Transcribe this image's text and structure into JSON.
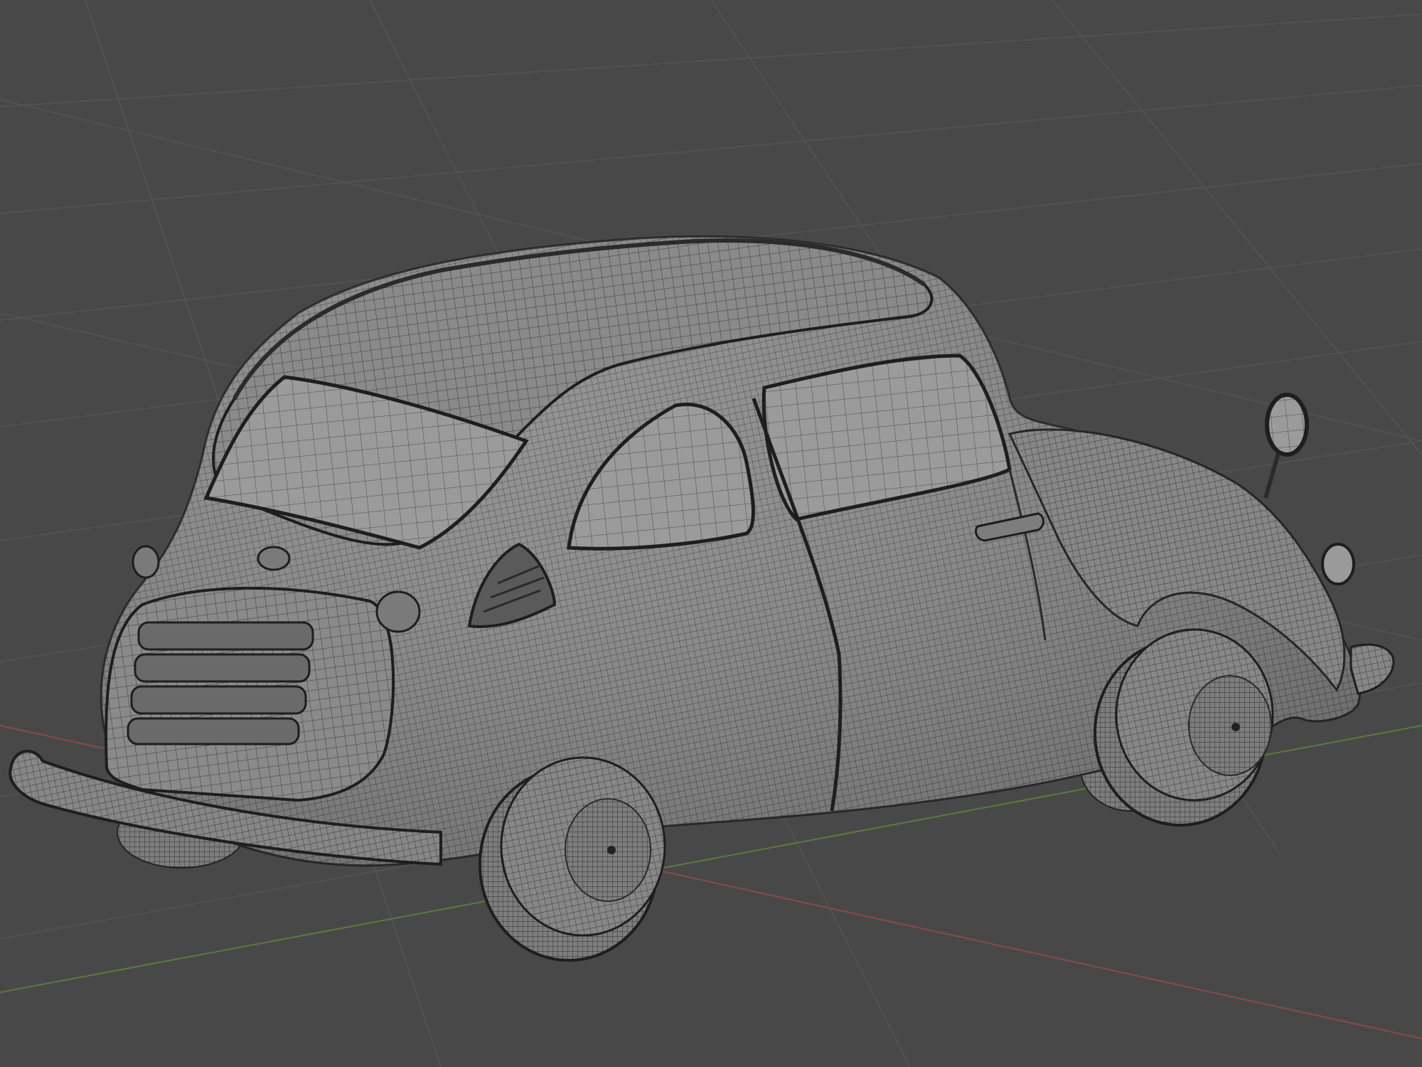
{
  "viewport": {
    "name": "3D Viewport",
    "shading": "solid-wireframe",
    "background_color": "#484848",
    "grid_color": "#545454",
    "x_axis_color": "#8a4a4a",
    "y_axis_color": "#5b7a3c"
  },
  "object": {
    "name": "car-model",
    "body_color": "#8c8c8c",
    "wire_color": "#2a2a2a",
    "glass_color": "#9a9a9a",
    "tire_color": "#3a3a3a"
  }
}
